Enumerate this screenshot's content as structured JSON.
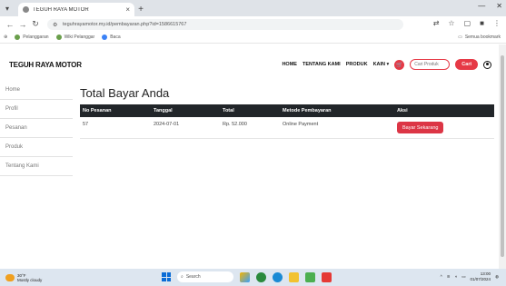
{
  "browser": {
    "tab_title": "TEGUH RAYA MOTOR",
    "tab_close": "×",
    "new_tab": "+",
    "url": "teguhrayamotor.my.id/pembayaran.php?id=1586615767",
    "bookmarks": [
      {
        "label": "Pelanggaran"
      },
      {
        "label": "Wiki Pelanggar"
      },
      {
        "label": "Baca"
      }
    ],
    "bookmarks_right": "Semua bookmark"
  },
  "header": {
    "brand": "TEGUH RAYA MOTOR",
    "nav": [
      "HOME",
      "TENTANG KAMI",
      "PRODUK",
      "KAIN ▾"
    ],
    "search_placeholder": "Cari Produk",
    "search_button": "Cari"
  },
  "sidebar": {
    "items": [
      "Home",
      "Profil",
      "Pesanan",
      "Produk",
      "Tentang Kami"
    ]
  },
  "main": {
    "title": "Total Bayar Anda",
    "columns": [
      "No Pesanan",
      "Tanggal",
      "Total",
      "Metode Pembayaran",
      "Aksi"
    ],
    "rows": [
      {
        "no": "57",
        "tanggal": "2024-07-01",
        "total": "Rp. 52.000",
        "metode": "Online Payment",
        "aksi": "Bayar Sekarang"
      }
    ]
  },
  "taskbar": {
    "weather_temp": "30°F",
    "weather_desc": "Mostly cloudy",
    "search_label": "Search",
    "time": "13:00",
    "date": "01/07/2024"
  }
}
